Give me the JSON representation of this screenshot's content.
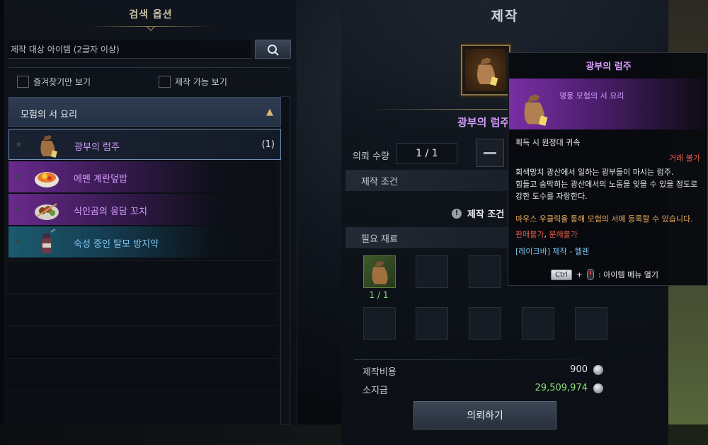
{
  "search": {
    "title": "검색 옵션",
    "placeholder": "제작 대상 아이템 (2글자 이상)",
    "favorites_only": "즐겨찾기만 보기",
    "craftable_only": "제작 가능 보기"
  },
  "category": {
    "label": "모험의 서 요리"
  },
  "items": [
    {
      "name": "광부의 럼주",
      "count": "(1)",
      "grade": "epic"
    },
    {
      "name": "에펜 계란덮밥",
      "count": "",
      "grade": "epic"
    },
    {
      "name": "식인곰의 웅담 꼬치",
      "count": "",
      "grade": "epic"
    },
    {
      "name": "숙성 중인 탈모 방지약",
      "count": "",
      "grade": "rare"
    }
  ],
  "craft": {
    "title": "제작",
    "item_name": "광부의 럼주",
    "quantity_label": "의뢰 수량",
    "quantity_value": "1 / 1",
    "conditions_label": "제작 조건",
    "conditions_message": "제작 조건",
    "materials_label": "필요 재료",
    "material_count": "1 / 1",
    "cost_label": "제작비용",
    "cost_value": "900",
    "funds_label": "소지금",
    "funds_value": "29,509,974",
    "request_button": "의뢰하기"
  },
  "tooltip": {
    "title": "광부의 럼주",
    "subtitle": "영웅 모험의 서 요리",
    "bound": "획득 시 원정대 귀속",
    "trade": "거래 불가",
    "desc1": "회색망치 광산에서 일하는 광부들이 마시는 럼주.",
    "desc2": "힘들고 숨막히는 광산에서의 노동을 잊을 수 있을 정도로",
    "desc3": "강한 도수를 자랑한다.",
    "register": "마우스 우클릭을 통해 모험의 서에 등록할 수 있습니다.",
    "sell_no": "판매불가",
    "comma": ", ",
    "dismantle_no": "분해불가",
    "source": "[레이크바] 제작 - 헬렌",
    "key": "Ctrl",
    "plus": "+",
    "menu_hint": ": 아이템 메뉴 열기"
  },
  "colors": {
    "epic": "#d59cff",
    "rare": "#7ec8f2",
    "success": "#8ee07a",
    "warning": "#e05a4a"
  },
  "icons": {
    "search": "search-icon",
    "collapse": "chevron-up-icon",
    "star": "star-icon",
    "info": "info-icon",
    "coin": "silver-coin-icon"
  }
}
